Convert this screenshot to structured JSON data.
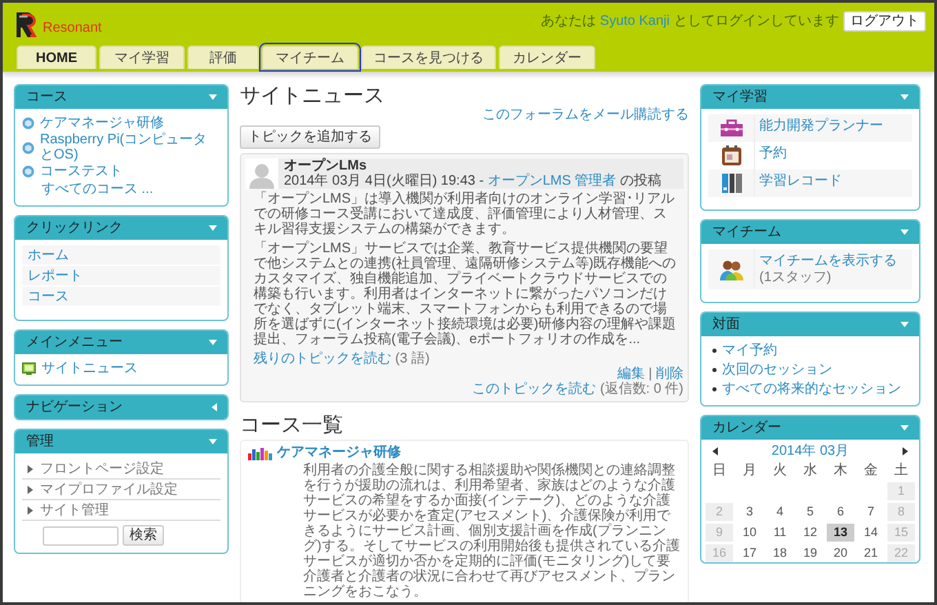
{
  "header": {
    "logo_text": "Resonant",
    "login_prefix": "あなたは",
    "user_name": "Syuto Kanji",
    "login_suffix": "としてログインしています",
    "logout_button": "ログアウト"
  },
  "tabs": [
    {
      "label": "HOME",
      "selected": true,
      "outlined": false
    },
    {
      "label": "マイ学習",
      "selected": false,
      "outlined": false
    },
    {
      "label": "評価",
      "selected": false,
      "outlined": false
    },
    {
      "label": "マイチーム",
      "selected": false,
      "outlined": true
    },
    {
      "label": "コースを見つける",
      "selected": false,
      "outlined": false
    },
    {
      "label": "カレンダー",
      "selected": false,
      "outlined": false
    }
  ],
  "left_blocks": [
    {
      "kind": "course-list",
      "title": "コース",
      "expanded": true,
      "items": [
        "ケアマネージャ研修",
        "Raspberry Pi(コンピュータとOS)",
        "コーステスト"
      ],
      "more_link": "すべてのコース ..."
    },
    {
      "kind": "link-table",
      "title": "クリックリンク",
      "expanded": true,
      "items": [
        "ホーム",
        "レポート",
        "コース"
      ]
    },
    {
      "kind": "menu",
      "title": "メインメニュー",
      "expanded": true,
      "items": [
        "サイトニュース"
      ]
    },
    {
      "kind": "empty",
      "title": "ナビゲーション",
      "expanded": false
    },
    {
      "kind": "admin",
      "title": "管理",
      "expanded": true,
      "items": [
        "フロントページ設定",
        "マイプロファイル設定",
        "サイト管理"
      ],
      "search_button": "検索"
    }
  ],
  "news": {
    "title": "サイトニュース",
    "subscribe_link": "このフォーラムをメール購読する",
    "add_button": "トピックを追加する",
    "post": {
      "author": "オープンLMs",
      "date": "2014年 03月 4日(火曜日) 19:43 - ",
      "byline_link": "オープンLMS 管理者",
      "byline_suffix": " の投稿",
      "paragraphs": [
        "「オープンLMS」は導入機関が利用者向けのオンライン学習･リアルでの研修コース受講において達成度、評価管理により人材管理、スキル習得支援システムの構築ができます。",
        "「オープンLMS」サービスでは企業、教育サービス提供機関の要望で他システムとの連携(社員管理、遠隔研修システム等)既存機能へのカスタマイズ、独自機能追加、プライベートクラウドサービスでの構築も行います。利用者はインターネットに繋がったパソコンだけでなく、タブレット端末、スマートフォンからも利用できるので場所を選ばずに(インターネット接続環境は必要)研修内容の理解や課題提出、フォーラム投稿(電子会議)、eポートフォリオの作成を..."
      ],
      "read_rest_link": "残りのトピックを読む",
      "word_count": "(3 語)",
      "edit_link": "編集",
      "separator": "|",
      "delete_link": "削除",
      "read_topic_link": "このトピックを読む",
      "reply_count": "(返信数: 0 件)"
    }
  },
  "course_list": {
    "title": "コース一覧",
    "courses": [
      {
        "name": "ケアマネージャ研修",
        "description": "利用者の介護全般に関する相談援助や関係機関との連絡調整を行うが援助の流れは、利用希望者、家族はどのような介護サービスの希望をするか面接(インテーク)、どのような介護サービスが必要かを査定(アセスメント)、介護保険が利用できるようにサービス計画、個別支援計画を作成(プランニング)する。そしてサービスの利用開始後も提供されている介護サービスが適切か否かを定期的に評価(モニタリング)して要介護者と介護者の状況に合わせて再びアセスメント、プランニングをおこなう。"
      }
    ]
  },
  "right_blocks": [
    {
      "kind": "icon-table",
      "title": "マイ学習",
      "expanded": true,
      "items": [
        {
          "kind": "toolbox",
          "label": "能力開発プランナー"
        },
        {
          "kind": "calendar",
          "label": "予約"
        },
        {
          "kind": "binders",
          "label": "学習レコード"
        }
      ]
    },
    {
      "kind": "team",
      "title": "マイチーム",
      "expanded": true,
      "link": "マイチームを表示する",
      "note": "(1スタッフ)"
    },
    {
      "kind": "bullets",
      "title": "対面",
      "expanded": true,
      "items": [
        "マイ予約",
        "次回のセッション",
        "すべての将来的なセッション"
      ]
    },
    {
      "kind": "calendar",
      "title": "カレンダー",
      "expanded": true,
      "month": "2014年 03月",
      "weekdays": [
        "日",
        "月",
        "火",
        "水",
        "木",
        "金",
        "土"
      ],
      "weeks": [
        [
          {
            "day": "1",
            "weekend": true,
            "today": false
          }
        ],
        [
          {
            "day": "2",
            "weekend": true,
            "today": false
          },
          {
            "day": "3",
            "weekend": false,
            "today": false
          },
          {
            "day": "4",
            "weekend": false,
            "today": false
          },
          {
            "day": "5",
            "weekend": false,
            "today": false
          },
          {
            "day": "6",
            "weekend": false,
            "today": false
          },
          {
            "day": "7",
            "weekend": false,
            "today": false
          },
          {
            "day": "8",
            "weekend": true,
            "today": false
          }
        ],
        [
          {
            "day": "9",
            "weekend": true,
            "today": false
          },
          {
            "day": "10",
            "weekend": false,
            "today": false
          },
          {
            "day": "11",
            "weekend": false,
            "today": false
          },
          {
            "day": "12",
            "weekend": false,
            "today": false
          },
          {
            "day": "13",
            "weekend": false,
            "today": true
          },
          {
            "day": "14",
            "weekend": false,
            "today": false
          },
          {
            "day": "15",
            "weekend": true,
            "today": false
          }
        ],
        [
          {
            "day": "16",
            "weekend": true,
            "today": false
          },
          {
            "day": "17",
            "weekend": false,
            "today": false
          },
          {
            "day": "18",
            "weekend": false,
            "today": false
          },
          {
            "day": "19",
            "weekend": false,
            "today": false
          },
          {
            "day": "20",
            "weekend": false,
            "today": false
          },
          {
            "day": "21",
            "weekend": false,
            "today": false
          },
          {
            "day": "22",
            "weekend": true,
            "today": false
          }
        ]
      ]
    }
  ]
}
